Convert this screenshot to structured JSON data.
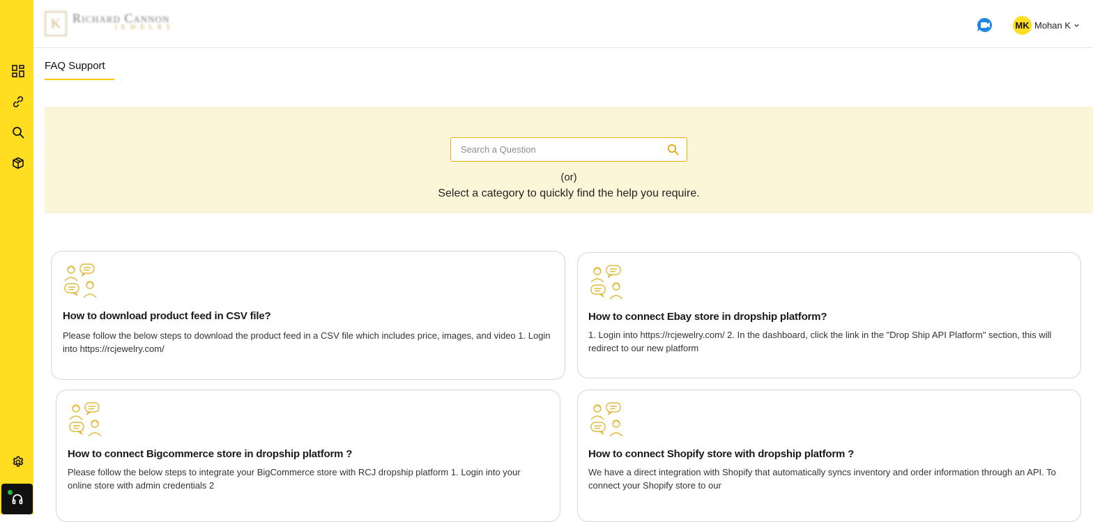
{
  "colors": {
    "accent": "#ffde21",
    "border_accent": "#ecb100",
    "banner_bg": "#fcf6d8",
    "icon_gold": "#e2b93b"
  },
  "brand": {
    "logo_main": "Richard Cannon",
    "logo_sub": "JEWELRY"
  },
  "sidebar": {
    "items": [
      {
        "icon": "dashboard-icon"
      },
      {
        "icon": "link-icon"
      },
      {
        "icon": "search-icon"
      },
      {
        "icon": "package-icon"
      }
    ],
    "settings_icon": "gear-icon",
    "support_icon": "headset-icon"
  },
  "header": {
    "video_icon": "video-call-icon",
    "user": {
      "initials": "MK",
      "name": "Mohan K"
    }
  },
  "page": {
    "tab_label": "FAQ Support"
  },
  "search": {
    "placeholder": "Search a Question",
    "value": "",
    "or_text": "(or)",
    "help_text": "Select a category to quickly find the help you require."
  },
  "faq_cards": [
    {
      "title": "How to download product feed in CSV file?",
      "body": " Please follow the below steps to download the product feed in a CSV file which includes price, images, and video 1. Login into https://rcjewelry.com/"
    },
    {
      "title": "How to connect Ebay store in dropship platform?",
      "body": "1. Login into https://rcjewelry.com/  2. In the dashboard, click the link in the \"Drop Ship API Platform\" section, this will redirect to our new platform"
    },
    {
      "title": "How to connect Bigcommerce store in dropship platform ?",
      "body": " Please follow the below steps to integrate your BigCommerce store with RCJ dropship platform  1. Login into your online store with admin credentials  2"
    },
    {
      "title": "How to connect Shopify store with dropship platform ?",
      "body": " We have a direct integration with Shopify that automatically syncs inventory and order information through an API. To connect your Shopify store to our"
    }
  ]
}
